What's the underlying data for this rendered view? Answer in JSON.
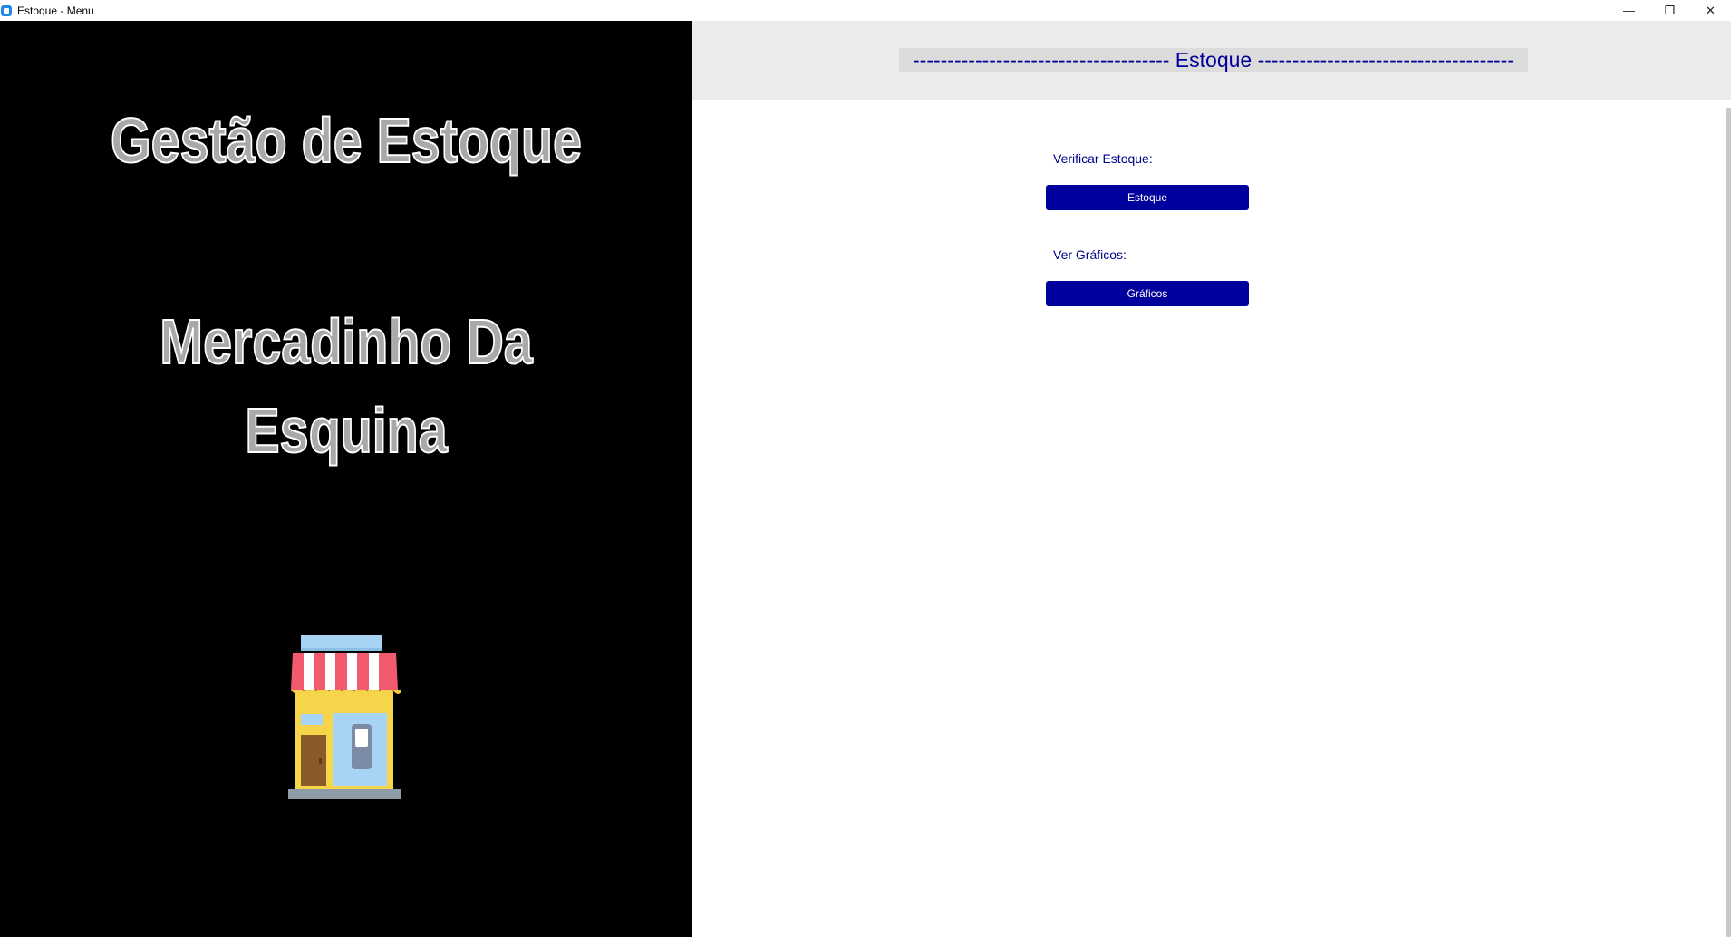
{
  "window": {
    "title": "Estoque - Menu",
    "minimize_glyph": "—",
    "restore_glyph": "❐",
    "close_glyph": "✕"
  },
  "left_panel": {
    "title": "Gestão de Estoque",
    "subtitle_line1": "Mercadinho Da",
    "subtitle_line2": "Esquina",
    "image_icon": "store-icon"
  },
  "right_panel": {
    "header": "------------------------------------- Estoque -------------------------------------",
    "sections": [
      {
        "label": "Verificar Estoque:",
        "button": "Estoque"
      },
      {
        "label": "Ver Gráficos:",
        "button": "Gráficos"
      }
    ]
  },
  "colors": {
    "accent": "#00009c",
    "label_text": "#00008b",
    "header_band": "#ebebeb",
    "left_background": "#000000"
  }
}
